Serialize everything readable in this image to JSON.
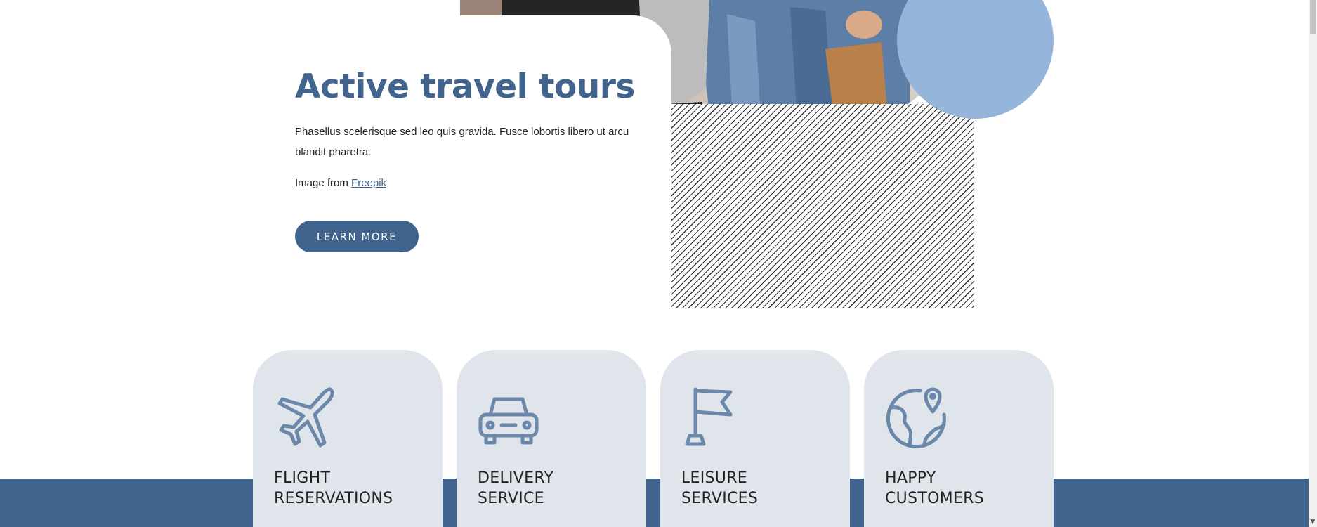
{
  "hero": {
    "title": "Active travel tours",
    "description": "Phasellus scelerisque sed leo quis gravida. Fusce lobortis libero ut arcu blandit pharetra.",
    "credit_prefix": "Image from ",
    "credit_link": "Freepik",
    "button_label": "LEARN MORE",
    "image_subject": "couple in denim jackets",
    "accent_color": "#96b5da",
    "brand_color": "#40648e"
  },
  "features": [
    {
      "icon": "airplane-icon",
      "label": "FLIGHT\nRESERVATIONS"
    },
    {
      "icon": "car-icon",
      "label": "DELIVERY\nSERVICE"
    },
    {
      "icon": "flag-icon",
      "label": "LEISURE\nSERVICES"
    },
    {
      "icon": "globe-pin-icon",
      "label": "HAPPY\nCUSTOMERS"
    }
  ],
  "colors": {
    "card_background": "#e0e5ec",
    "band_background": "#40648e",
    "icon_color": "#6b87aa"
  },
  "scrollbar": {
    "down_arrow": "▼"
  }
}
